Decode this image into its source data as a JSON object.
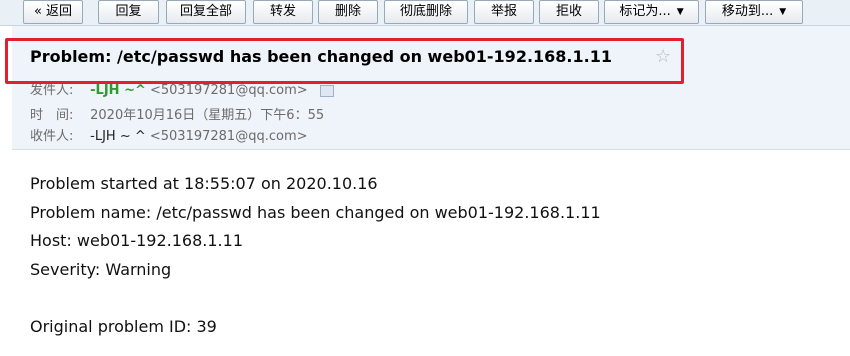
{
  "toolbar": {
    "back": "« 返回",
    "reply": "回复",
    "reply_all": "回复全部",
    "forward": "转发",
    "delete": "删除",
    "delete_permanently": "彻底删除",
    "report": "举报",
    "reject": "拒收",
    "mark_as": "标记为...",
    "move_to": "移动到..."
  },
  "email": {
    "subject": "Problem: /etc/passwd has been changed on web01-192.168.1.11",
    "from_label": "发件人:",
    "from_name": "-LJH ~^",
    "from_address": "<503197281@qq.com>",
    "time_label": "时　间:",
    "time_value": "2020年10月16日（星期五）下午6：55",
    "to_label": "收件人:",
    "to_name": "-LJH ~ ^",
    "to_address": "<503197281@qq.com>"
  },
  "body": {
    "line1": "Problem started at 18:55:07 on 2020.10.16",
    "line2": "Problem name: /etc/passwd has been changed on web01-192.168.1.11",
    "line3": "Host: web01-192.168.1.11",
    "line4": "Severity: Warning",
    "line5": "Original problem ID: 39"
  },
  "colors": {
    "highlight_border": "#e3202a",
    "sender_name": "#2d9b2d",
    "header_bg": "#eef4fa"
  }
}
